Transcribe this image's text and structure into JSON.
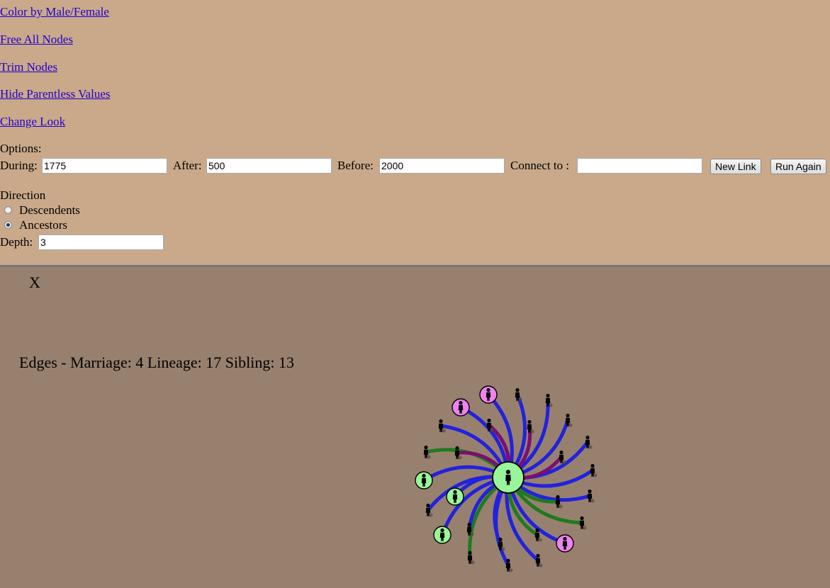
{
  "links": {
    "color_by": "Color by Male/Female",
    "free_all": "Free All Nodes",
    "trim": "Trim Nodes",
    "hide_parentless": "Hide Parentless Values",
    "change_look": "Change Look"
  },
  "options": {
    "heading": "Options:",
    "during_label": "During:",
    "during_value": "1775",
    "after_label": "After:",
    "after_value": "500",
    "before_label": "Before:",
    "before_value": "2000",
    "connect_label": "Connect to :",
    "connect_value": "",
    "new_link_button": "New Link",
    "run_again_button": "Run Again"
  },
  "direction": {
    "heading": "Direction",
    "descendents_label": "Descendents",
    "ancestors_label": "Ancestors",
    "selected": "Ancestors",
    "depth_label": "Depth:",
    "depth_value": "3"
  },
  "graph": {
    "close_label": "X",
    "edges_summary": "Edges - Marriage: 4 Lineage: 17 Sibling: 13",
    "colors": {
      "lineage": "#2222dd",
      "sibling": "#1f7a1f",
      "marriage": "#7a1070",
      "male": "#99f599",
      "female": "#ee82ee",
      "background": "#98806e",
      "panel": "#c9a98a"
    },
    "icon": "person-icon"
  }
}
